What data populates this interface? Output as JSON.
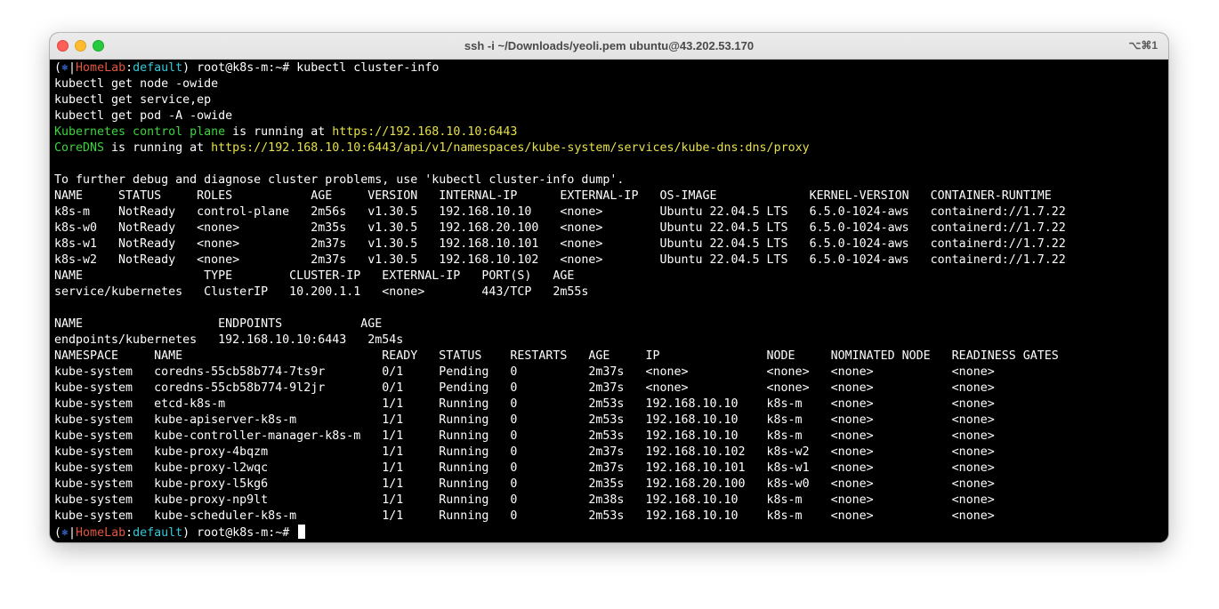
{
  "window": {
    "title": "ssh -i ~/Downloads/yeoli.pem ubuntu@43.202.53.170",
    "shortcut": "⌥⌘1"
  },
  "prompt": {
    "open": "(",
    "symbol": "⎈",
    "separator": "|",
    "cluster": "HomeLab",
    "colon": ":",
    "namespace": "default",
    "close_and_user": ") root@k8s-m:~# "
  },
  "commands": [
    "kubectl cluster-info",
    "kubectl get node -owide",
    "kubectl get service,ep",
    "kubectl get pod -A -owide"
  ],
  "cluster_info": {
    "cp_name": "Kubernetes control plane",
    "cp_mid": " is running at ",
    "cp_url": "https://192.168.10.10:6443",
    "dns_name": "CoreDNS",
    "dns_mid": " is running at ",
    "dns_url": "https://192.168.10.10:6443/api/v1/namespaces/kube-system/services/kube-dns:dns/proxy",
    "debug_hint": "To further debug and diagnose cluster problems, use 'kubectl cluster-info dump'."
  },
  "nodes": {
    "header": "NAME     STATUS     ROLES           AGE     VERSION   INTERNAL-IP      EXTERNAL-IP   OS-IMAGE             KERNEL-VERSION   CONTAINER-RUNTIME",
    "rows": [
      "k8s-m    NotReady   control-plane   2m56s   v1.30.5   192.168.10.10    <none>        Ubuntu 22.04.5 LTS   6.5.0-1024-aws   containerd://1.7.22",
      "k8s-w0   NotReady   <none>          2m35s   v1.30.5   192.168.20.100   <none>        Ubuntu 22.04.5 LTS   6.5.0-1024-aws   containerd://1.7.22",
      "k8s-w1   NotReady   <none>          2m37s   v1.30.5   192.168.10.101   <none>        Ubuntu 22.04.5 LTS   6.5.0-1024-aws   containerd://1.7.22",
      "k8s-w2   NotReady   <none>          2m37s   v1.30.5   192.168.10.102   <none>        Ubuntu 22.04.5 LTS   6.5.0-1024-aws   containerd://1.7.22"
    ]
  },
  "services": {
    "header": "NAME                 TYPE        CLUSTER-IP   EXTERNAL-IP   PORT(S)   AGE",
    "rows": [
      "service/kubernetes   ClusterIP   10.200.1.1   <none>        443/TCP   2m55s"
    ]
  },
  "endpoints": {
    "header": "NAME                   ENDPOINTS           AGE",
    "rows": [
      "endpoints/kubernetes   192.168.10.10:6443   2m54s"
    ]
  },
  "pods": {
    "header": "NAMESPACE     NAME                            READY   STATUS    RESTARTS   AGE     IP               NODE     NOMINATED NODE   READINESS GATES",
    "rows": [
      "kube-system   coredns-55cb58b774-7ts9r        0/1     Pending   0          2m37s   <none>           <none>   <none>           <none>",
      "kube-system   coredns-55cb58b774-9l2jr        0/1     Pending   0          2m37s   <none>           <none>   <none>           <none>",
      "kube-system   etcd-k8s-m                      1/1     Running   0          2m53s   192.168.10.10    k8s-m    <none>           <none>",
      "kube-system   kube-apiserver-k8s-m            1/1     Running   0          2m53s   192.168.10.10    k8s-m    <none>           <none>",
      "kube-system   kube-controller-manager-k8s-m   1/1     Running   0          2m53s   192.168.10.10    k8s-m    <none>           <none>",
      "kube-system   kube-proxy-4bqzm                1/1     Running   0          2m37s   192.168.10.102   k8s-w2   <none>           <none>",
      "kube-system   kube-proxy-l2wqc                1/1     Running   0          2m37s   192.168.10.101   k8s-w1   <none>           <none>",
      "kube-system   kube-proxy-l5kg6                1/1     Running   0          2m35s   192.168.20.100   k8s-w0   <none>           <none>",
      "kube-system   kube-proxy-np9lt                1/1     Running   0          2m38s   192.168.10.10    k8s-m    <none>           <none>",
      "kube-system   kube-scheduler-k8s-m            1/1     Running   0          2m53s   192.168.10.10    k8s-m    <none>           <none>"
    ]
  }
}
